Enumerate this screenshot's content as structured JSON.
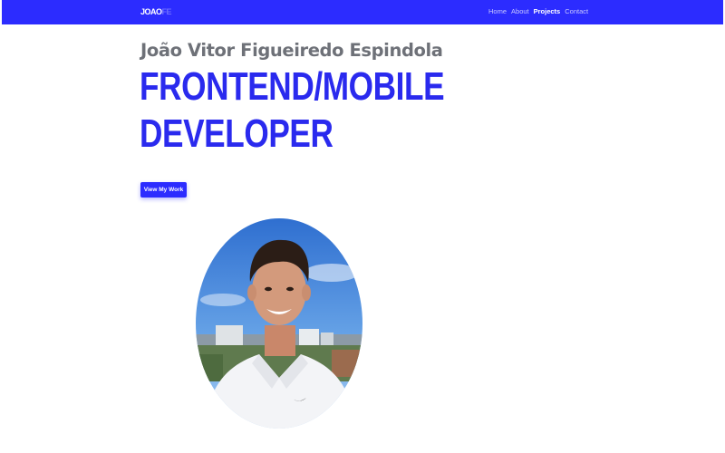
{
  "nav": {
    "brand_main": "JOAO",
    "brand_suffix": "FE",
    "links": [
      "Home",
      "About",
      "Projects",
      "Contact"
    ],
    "active": "Projects"
  },
  "hero": {
    "name": "João Vitor Figueiredo Espindola",
    "role_line1": "FRONTEND/MOBILE",
    "role_line2": "DEVELOPER",
    "button": "View My Work"
  },
  "colors": {
    "primary": "#2c2cff",
    "name_gray": "#6e7178"
  }
}
